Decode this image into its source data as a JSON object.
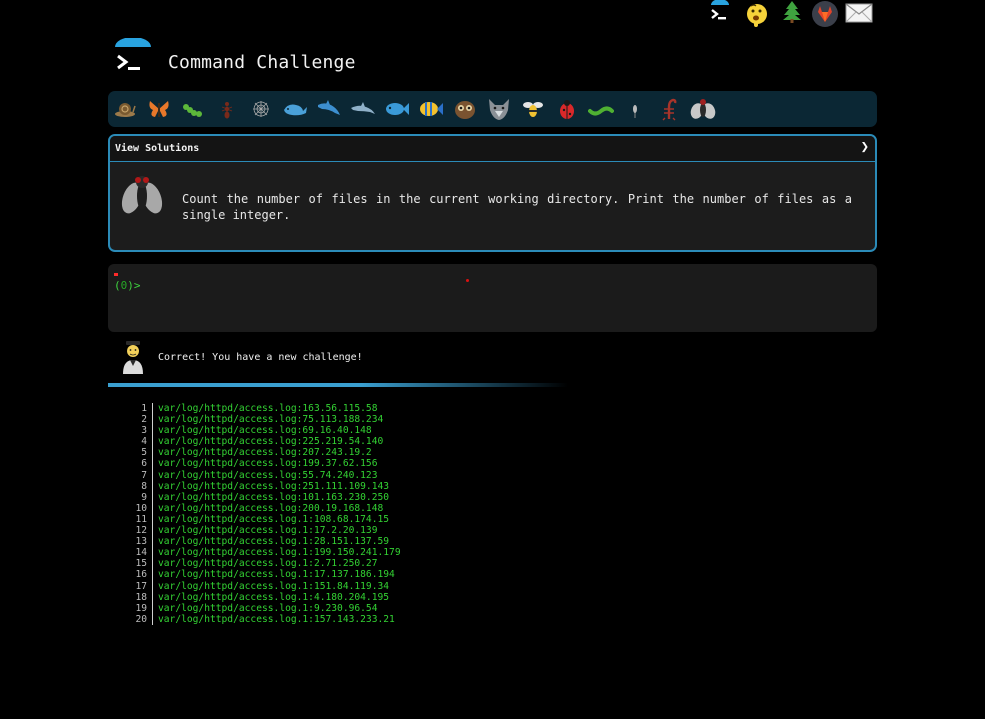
{
  "header": {
    "links": [
      {
        "name": "command-challenge-icon"
      },
      {
        "name": "emoji-face-icon"
      },
      {
        "name": "tree-icon"
      },
      {
        "name": "gitlab-icon"
      },
      {
        "name": "mail-icon"
      }
    ]
  },
  "brand": {
    "title": "Command Challenge"
  },
  "levels": [
    "snail-icon",
    "butterfly-icon",
    "caterpillar-icon",
    "ant-icon",
    "spiderweb-icon",
    "whale-icon",
    "dolphin-icon",
    "dolphin-2-icon",
    "fish-icon",
    "tropical-fish-icon",
    "owl-icon",
    "wolf-icon",
    "bee-icon",
    "ladybug-icon",
    "worm-icon",
    "mosquito-icon",
    "scorpion-icon",
    "fly-icon"
  ],
  "challenge": {
    "view_solutions_label": "View Solutions",
    "chevron": "❯",
    "description": "Count the number of files in the current working directory. Print the number of files as a single integer."
  },
  "terminal": {
    "prompt_prefix": "(",
    "prompt_exit_code": "0",
    "prompt_suffix": ")>"
  },
  "feedback": {
    "message": "Correct! You have a new challenge!"
  },
  "output": [
    {
      "n": "1",
      "text": "var/log/httpd/access.log:163.56.115.58"
    },
    {
      "n": "2",
      "text": "var/log/httpd/access.log:75.113.188.234"
    },
    {
      "n": "3",
      "text": "var/log/httpd/access.log:69.16.40.148"
    },
    {
      "n": "4",
      "text": "var/log/httpd/access.log:225.219.54.140"
    },
    {
      "n": "5",
      "text": "var/log/httpd/access.log:207.243.19.2"
    },
    {
      "n": "6",
      "text": "var/log/httpd/access.log:199.37.62.156"
    },
    {
      "n": "7",
      "text": "var/log/httpd/access.log:55.74.240.123"
    },
    {
      "n": "8",
      "text": "var/log/httpd/access.log:251.111.109.143"
    },
    {
      "n": "9",
      "text": "var/log/httpd/access.log:101.163.230.250"
    },
    {
      "n": "10",
      "text": "var/log/httpd/access.log:200.19.168.148"
    },
    {
      "n": "11",
      "text": "var/log/httpd/access.log.1:108.68.174.15"
    },
    {
      "n": "12",
      "text": "var/log/httpd/access.log.1:17.2.20.139"
    },
    {
      "n": "13",
      "text": "var/log/httpd/access.log.1:28.151.137.59"
    },
    {
      "n": "14",
      "text": "var/log/httpd/access.log.1:199.150.241.179"
    },
    {
      "n": "15",
      "text": "var/log/httpd/access.log.1:2.71.250.27"
    },
    {
      "n": "16",
      "text": "var/log/httpd/access.log.1:17.137.186.194"
    },
    {
      "n": "17",
      "text": "var/log/httpd/access.log.1:151.84.119.34"
    },
    {
      "n": "18",
      "text": "var/log/httpd/access.log.1:4.180.204.195"
    },
    {
      "n": "19",
      "text": "var/log/httpd/access.log.1:9.230.96.54"
    },
    {
      "n": "20",
      "text": "var/log/httpd/access.log.1:157.143.233.21"
    }
  ],
  "colors": {
    "accent": "#2b8bb8",
    "terminal_green": "#33d233",
    "background": "#000000"
  }
}
